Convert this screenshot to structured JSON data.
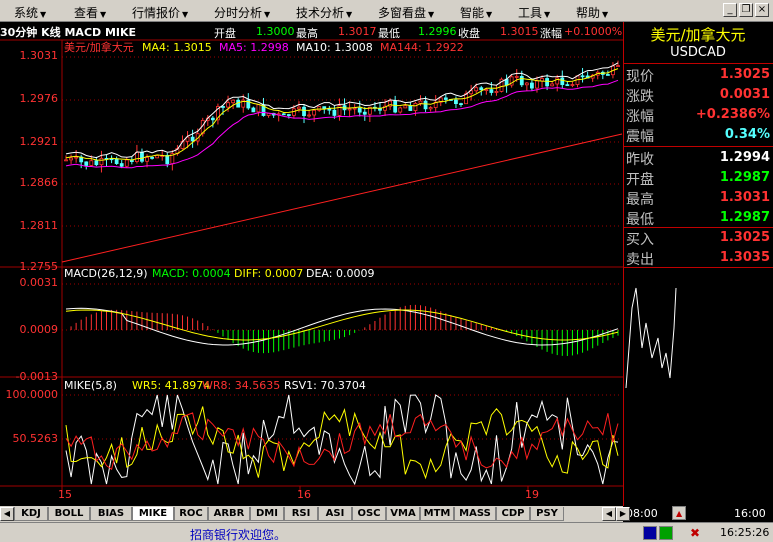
{
  "menu": [
    {
      "label": "系统",
      "x": 14
    },
    {
      "label": "查看",
      "x": 74
    },
    {
      "label": "行情报价",
      "x": 132
    },
    {
      "label": "分时分析",
      "x": 214
    },
    {
      "label": "技术分析",
      "x": 296
    },
    {
      "label": "多窗看盘",
      "x": 378
    },
    {
      "label": "智能",
      "x": 460
    },
    {
      "label": "工具",
      "x": 518
    },
    {
      "label": "帮助",
      "x": 576
    }
  ],
  "chart": {
    "period_label": "30分钟 K线 MACD MIKE",
    "header": {
      "open_label": "开盘",
      "open": "1.3000",
      "high_label": "最高",
      "high": "1.3017",
      "low_label": "最低",
      "low": "1.2996",
      "close_label": "收盘",
      "close": "1.3015",
      "change_label": "涨幅",
      "change": "+0.1000%"
    },
    "ma_legend": {
      "name": "美元/加拿大元",
      "ma4": "MA4: 1.3015",
      "ma5": "MA5: 1.2998",
      "ma10": "MA10: 1.3008",
      "ma144": "MA144: 1.2922"
    },
    "macd_legend": {
      "name": "MACD(26,12,9)",
      "macd": "MACD: 0.0004",
      "diff": "DIFF: 0.0007",
      "dea": "DEA: 0.0009"
    },
    "mike_legend": {
      "name": "MIKE(5,8)",
      "wr5": "WR5: 41.8974",
      "wr8": "WR8: 34.5635",
      "rsv1": "RSV1: 70.3704"
    },
    "price_ticks": [
      "1.3031",
      "1.2976",
      "1.2921",
      "1.2866",
      "1.2811",
      "1.2755"
    ],
    "macd_ticks": [
      "0.0031",
      "0.0009",
      "-0.0013"
    ],
    "mike_ticks": [
      "100.0000",
      "50.5263"
    ],
    "x_ticks": [
      "15",
      "16",
      "19"
    ]
  },
  "colors": {
    "up": "#ff3232",
    "down": "#54ffff",
    "ma4": "#ffffff",
    "ma5": "#ffff00",
    "ma10": "#ff00ff",
    "ma144": "#ff2020",
    "grid": "#a00000"
  },
  "quote": {
    "name": "美元/加拿大元",
    "code": "USDCAD",
    "rows": [
      {
        "label": "现价",
        "value": "1.3025",
        "color": "#ff3232"
      },
      {
        "label": "涨跌",
        "value": "0.0031",
        "color": "#ff3232"
      },
      {
        "label": "涨幅",
        "value": "+0.2386%",
        "color": "#ff3232"
      },
      {
        "label": "震幅",
        "value": "0.34%",
        "color": "#54ffff"
      },
      {
        "label": "昨收",
        "value": "1.2994",
        "color": "#ffffff"
      },
      {
        "label": "开盘",
        "value": "1.2987",
        "color": "#00ff00"
      },
      {
        "label": "最高",
        "value": "1.3031",
        "color": "#ff3232"
      },
      {
        "label": "最低",
        "value": "1.2987",
        "color": "#00ff00"
      },
      {
        "label": "买入",
        "value": "1.3025",
        "color": "#ff3232"
      },
      {
        "label": "卖出",
        "value": "1.3035",
        "color": "#ff3232"
      }
    ],
    "time_start": "08:00",
    "time_end": "16:00"
  },
  "tabs": [
    "KDJ",
    "BOLL",
    "BIAS",
    "MIKE",
    "ROC",
    "ARBR",
    "DMI",
    "RSI",
    "ASI",
    "OSC",
    "VMA",
    "MTM",
    "MASS",
    "CDP",
    "PSY"
  ],
  "active_tab": "MIKE",
  "status": {
    "ticker": "招商银行欢迎您。",
    "clock": "16:25:26"
  }
}
